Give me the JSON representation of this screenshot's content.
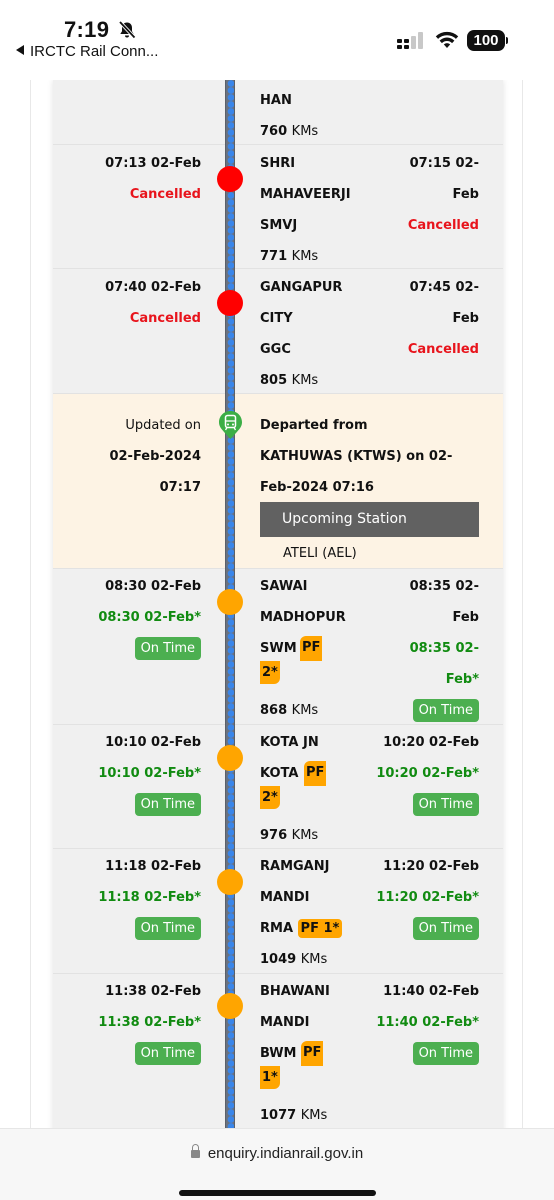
{
  "status_bar": {
    "time": "7:19",
    "back_label": "IRCTC Rail Conn...",
    "battery": "100",
    "icons": [
      "bell-slash-icon",
      "signal-icon",
      "wifi-icon",
      "battery-icon"
    ]
  },
  "colors": {
    "cancelled": "#e8141c",
    "on_time_text": "#118b11",
    "on_time_badge": "#4caf50",
    "platform_badge": "#ffa500",
    "cancelled_dot": "#ff0000",
    "upcoming_dot": "#ffa500",
    "current_row_bg": "#fdf3e4"
  },
  "kms_unit": "KMs",
  "stations": [
    {
      "name_lines": [
        "HAN"
      ],
      "kms": "760"
    },
    {
      "arrival_sched_lines": [
        "07:13 02-Feb"
      ],
      "arrival_status": "Cancelled",
      "name_lines": [
        "SHRI",
        "MAHAVEERJI"
      ],
      "code": "SMVJ",
      "departure_sched_lines": [
        "07:15 02-",
        "Feb"
      ],
      "departure_status": "Cancelled",
      "kms": "771"
    },
    {
      "arrival_sched_lines": [
        "07:40 02-Feb"
      ],
      "arrival_status": "Cancelled",
      "name_lines": [
        "GANGAPUR",
        "CITY"
      ],
      "code": "GGC",
      "departure_sched_lines": [
        "07:45 02-",
        "Feb"
      ],
      "departure_status": "Cancelled",
      "kms": "805"
    }
  ],
  "current_position": {
    "updated_label": "Updated on",
    "updated_date": "02-Feb-2024",
    "updated_time": "07:17",
    "message_lines": [
      "Departed from",
      "KATHUWAS (KTWS) on 02-",
      "Feb-2024 07:16"
    ],
    "upcoming_label": "Upcoming Station",
    "upcoming_station": "ATELI (AEL)"
  },
  "upcoming": [
    {
      "arrival_sched": "08:30 02-Feb",
      "arrival_expected": "08:30 02-Feb*",
      "arrival_badge": "On Time",
      "name_lines": [
        "SAWAI",
        "MADHOPUR"
      ],
      "code": "SWM",
      "platform_lines": [
        "PF",
        "2*"
      ],
      "departure_sched_lines": [
        "08:35 02-",
        "Feb"
      ],
      "departure_expected_lines": [
        "08:35 02-",
        "Feb*"
      ],
      "departure_badge": "On Time",
      "kms": "868"
    },
    {
      "arrival_sched": "10:10 02-Feb",
      "arrival_expected": "10:10 02-Feb*",
      "arrival_badge": "On Time",
      "name_lines": [
        "KOTA JN"
      ],
      "code": "KOTA",
      "platform_lines": [
        "PF",
        "2*"
      ],
      "departure_sched": "10:20 02-Feb",
      "departure_expected": "10:20 02-Feb*",
      "departure_badge": "On Time",
      "kms": "976"
    },
    {
      "arrival_sched": "11:18 02-Feb",
      "arrival_expected": "11:18 02-Feb*",
      "arrival_badge": "On Time",
      "name_lines": [
        "RAMGANJ",
        "MANDI"
      ],
      "code": "RMA",
      "platform": "PF 1*",
      "departure_sched": "11:20 02-Feb",
      "departure_expected": "11:20 02-Feb*",
      "departure_badge": "On Time",
      "kms": "1049"
    },
    {
      "arrival_sched": "11:38 02-Feb",
      "arrival_expected": "11:38 02-Feb*",
      "arrival_badge": "On Time",
      "name_lines": [
        "BHAWANI",
        "MANDI"
      ],
      "code": "BWM",
      "platform_lines": [
        "PF",
        "1*"
      ],
      "departure_sched": "11:40 02-Feb",
      "departure_expected": "11:40 02-Feb*",
      "departure_badge": "On Time",
      "kms": "1077"
    }
  ],
  "browser": {
    "url": "enquiry.indianrail.gov.in"
  }
}
